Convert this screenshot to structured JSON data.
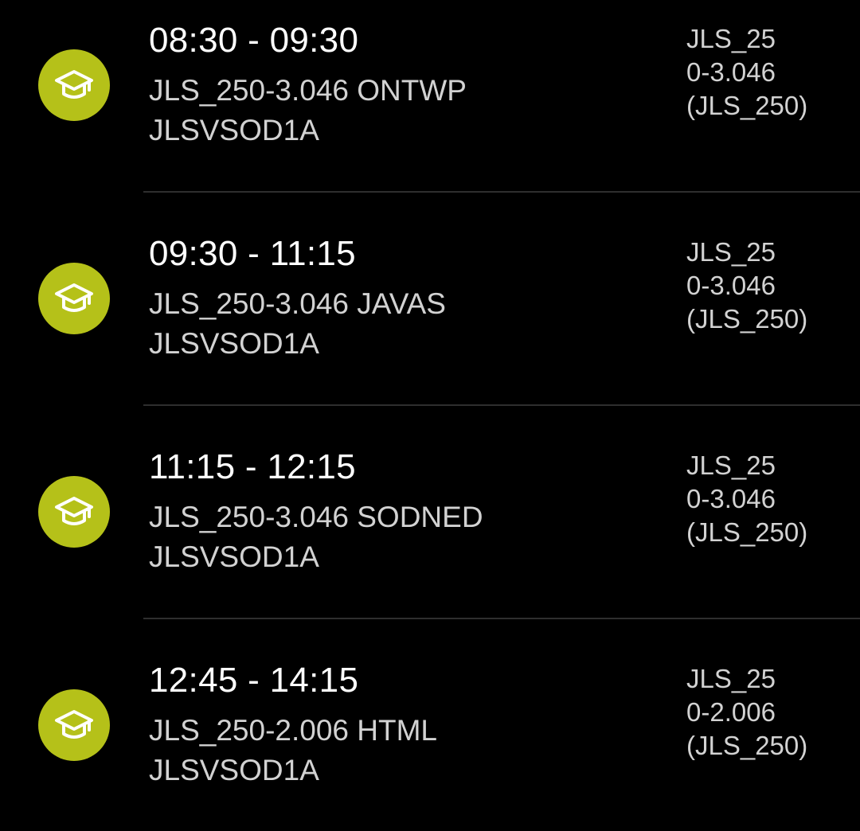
{
  "schedule": {
    "items": [
      {
        "icon": "graduation-cap-icon",
        "time": "08:30 - 09:30",
        "course": "JLS_250-3.046 ONTWP",
        "group": "JLSVSOD1A",
        "room_lines": [
          "JLS_25",
          "0-3.046",
          "(JLS_250)"
        ]
      },
      {
        "icon": "graduation-cap-icon",
        "time": "09:30 - 11:15",
        "course": "JLS_250-3.046 JAVAS",
        "group": "JLSVSOD1A",
        "room_lines": [
          "JLS_25",
          "0-3.046",
          "(JLS_250)"
        ]
      },
      {
        "icon": "graduation-cap-icon",
        "time": "11:15 - 12:15",
        "course": "JLS_250-3.046 SODNED",
        "group": "JLSVSOD1A",
        "room_lines": [
          "JLS_25",
          "0-3.046",
          "(JLS_250)"
        ]
      },
      {
        "icon": "graduation-cap-icon",
        "time": "12:45 - 14:15",
        "course": "JLS_250-2.006 HTML",
        "group": "JLSVSOD1A",
        "room_lines": [
          "JLS_25",
          "0-2.006",
          "(JLS_250)"
        ]
      }
    ]
  },
  "colors": {
    "background": "#000000",
    "icon_circle": "#b5c119",
    "icon_glyph": "#ffffff",
    "primary_text": "#ffffff",
    "secondary_text": "#d2d2d2",
    "divider": "#2e2e2e"
  }
}
